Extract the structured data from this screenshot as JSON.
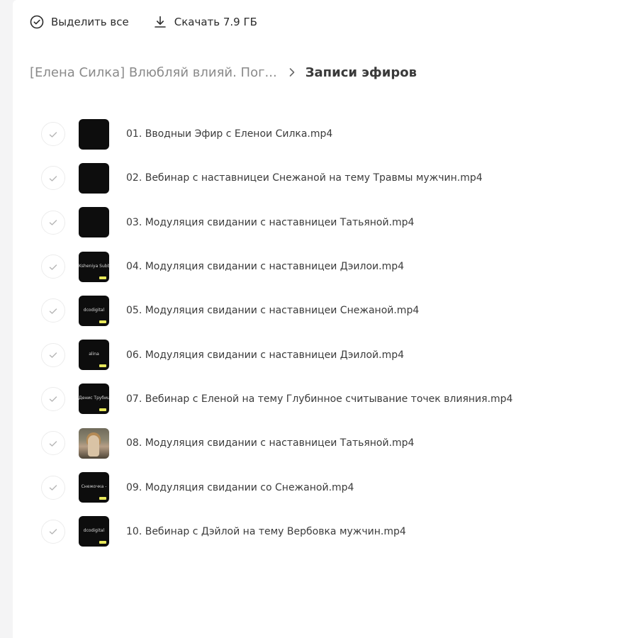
{
  "toolbar": {
    "select_all_label": "Выделить все",
    "download_label": "Скачать 7.9 ГБ"
  },
  "breadcrumb": {
    "parent": "[Елена Силка] Влюбляй влияй. Пог...",
    "current": "Записи эфиров"
  },
  "files": [
    {
      "name": "01. Вводныи Эфир с Еленои Силка.mp4",
      "thumb_text": ""
    },
    {
      "name": "02. Вебинар с наставницеи Снежаной на тему Травмы мужчин.mp4",
      "thumb_text": ""
    },
    {
      "name": "03. Модуляция свидании с наставницеи Татьяной.mp4",
      "thumb_text": ""
    },
    {
      "name": "04. Модуляция свидании с наставницеи Дэилои.mp4",
      "thumb_text": "Ksheniya Subbot"
    },
    {
      "name": "05. Модуляция свидании с наставницеи Снежаной.mp4",
      "thumb_text": "dcodigital"
    },
    {
      "name": "06. Модуляция свидании с наставницеи Дэилой.mp4",
      "thumb_text": "alina"
    },
    {
      "name": "07. Вебинар с Еленой на тему Глубинное считывание точек влияния.mp4",
      "thumb_text": "Денис Трубицын"
    },
    {
      "name": "08. Модуляция свидании с наставницеи Татьяной.mp4",
      "thumb_text": ""
    },
    {
      "name": "09. Модуляция свидании со Снежаной.mp4",
      "thumb_text": "Снежочка -"
    },
    {
      "name": "10. Вебинар с Дэйлой на тему Вербовка мужчин.mp4",
      "thumb_text": "dcodigital"
    }
  ],
  "colors": {
    "background": "#f4f4f5",
    "panel": "#ffffff",
    "text": "#2b2b2b",
    "muted": "#8a8a8a",
    "thumb_dark": "#0d0d0d",
    "badge": "#e8e85a"
  },
  "icons": {
    "select_all": "check-circle-icon",
    "download": "download-icon",
    "separator": "chevron-right-icon",
    "row_check": "check-icon"
  }
}
